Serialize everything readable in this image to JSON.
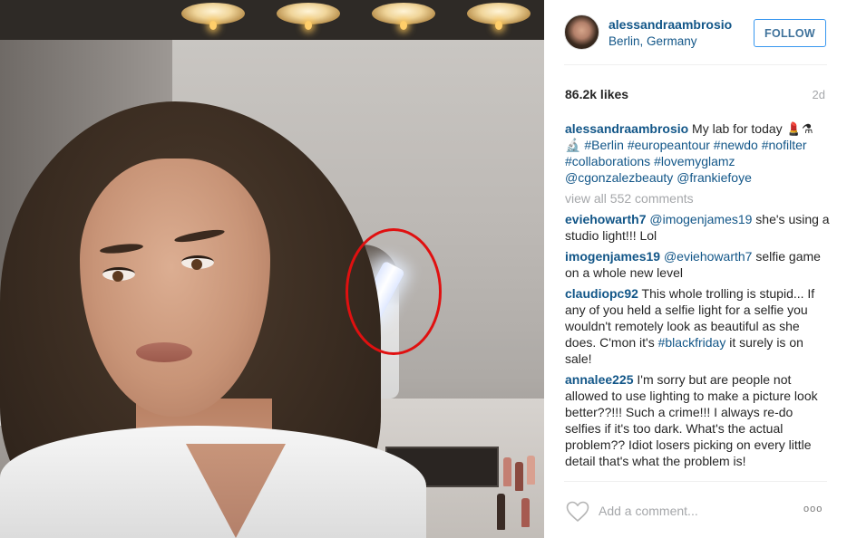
{
  "post": {
    "username": "alessandraambrosio",
    "location": "Berlin, Germany",
    "follow_label": "FOLLOW",
    "likes": "86.2k likes",
    "time_ago": "2d",
    "caption": {
      "user": "alessandraambrosio",
      "text": " My lab for today 💄⚗",
      "line2_prefix": "🔬 ",
      "tags_line2": [
        "#Berlin",
        "#europeantour",
        "#newdo",
        "#nofilter"
      ],
      "tags_line3": [
        "#collaborations",
        "#lovemyglamz"
      ],
      "tags_line4": [
        "@cgonzalezbeauty",
        "@frankiefoye"
      ]
    },
    "view_all_comments": "view all 552 comments",
    "comments": [
      {
        "user": "eviehowarth7",
        "mention": "@imogenjames19",
        "text": " she's using a studio light!!! Lol"
      },
      {
        "user": "imogenjames19",
        "mention": "@eviehowarth7",
        "text": " selfie game on a whole new level"
      },
      {
        "user": "claudiopc92",
        "text_before_tag": " This whole trolling is stupid... If any of you held a selfie light for a selfie you wouldn't remotely look as beautiful as she does. C'mon it's ",
        "tag": "#blackfriday",
        "text_after_tag": " it surely is on sale!"
      },
      {
        "user": "annalee225",
        "text": " I'm sorry but are people not allowed to use lighting to make a picture look better??!!! Such a crime!!! I always re-do selfies if it's too dark. What's the actual problem?? Idiot losers picking on every little detail that's what the problem is!"
      }
    ],
    "add_comment_placeholder": "Add a comment...",
    "more_options": "ooo"
  },
  "icons": {
    "heart": "heart-outline-icon",
    "more": "more-options-icon"
  },
  "colors": {
    "link_blue": "#125688",
    "follow_border": "#3897f0",
    "follow_text": "#3f729b",
    "muted_gray": "#a5a7aa",
    "annotation_red": "#e01010"
  }
}
